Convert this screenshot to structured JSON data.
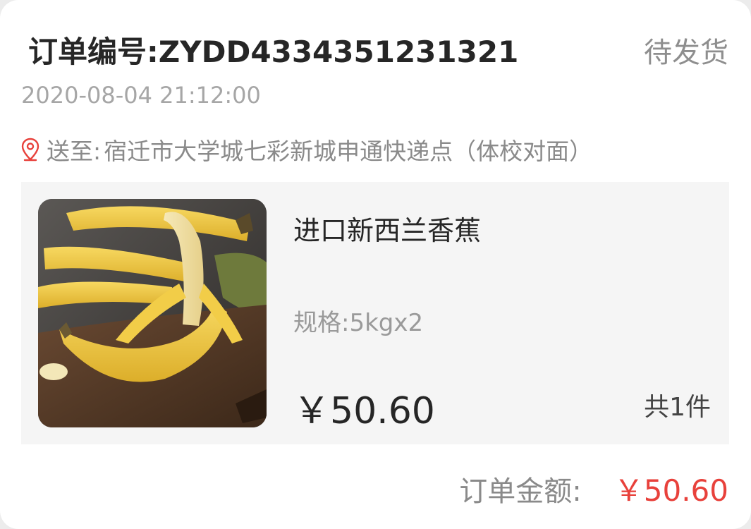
{
  "order": {
    "number_label": "订单编号:ZYDD4334351231321",
    "status": "待发货",
    "time": "2020-08-04   21:12:00",
    "address_prefix": "送至:",
    "address": "宿迁市大学城七彩新城申通快递点（体校对面）"
  },
  "product": {
    "name": "进口新西兰香蕉",
    "spec": "规格:5kgx2",
    "price": "￥50.60",
    "quantity": "共1件",
    "image_icon": "banana-photo"
  },
  "total": {
    "label": "订单金额:",
    "value": "￥50.60"
  },
  "colors": {
    "accent": "#e8413b",
    "pin": "#e8413b",
    "product_bg": "#f5f5f5"
  }
}
